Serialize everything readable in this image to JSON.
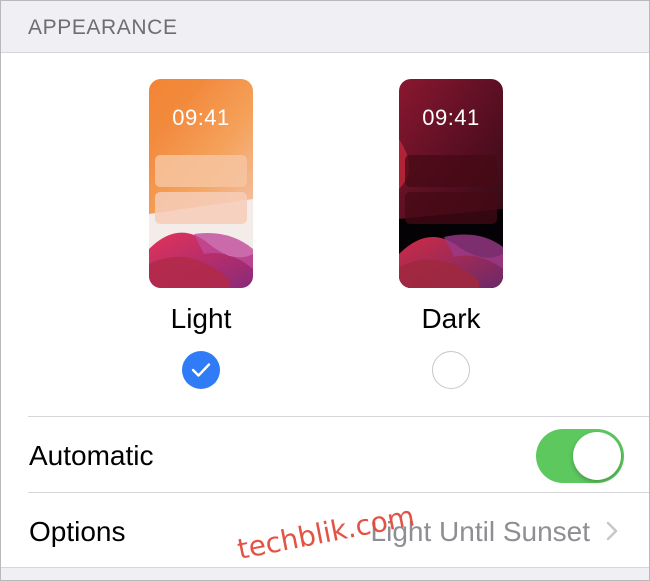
{
  "section": {
    "header": "APPEARANCE"
  },
  "appearance": {
    "options": [
      {
        "label": "Light",
        "time": "09:41",
        "selected": true
      },
      {
        "label": "Dark",
        "time": "09:41",
        "selected": false
      }
    ]
  },
  "settings": {
    "automatic": {
      "label": "Automatic",
      "enabled": true
    },
    "options": {
      "label": "Options",
      "value": "Light Until Sunset"
    }
  },
  "watermark": "techblik.com",
  "colors": {
    "accent": "#2f7cf6",
    "toggle_on": "#5cc85e",
    "secondary_text": "#8e8e93",
    "group_background": "#efeff4"
  },
  "icons": {
    "check": "checkmark-icon",
    "chevron": "chevron-right-icon"
  }
}
